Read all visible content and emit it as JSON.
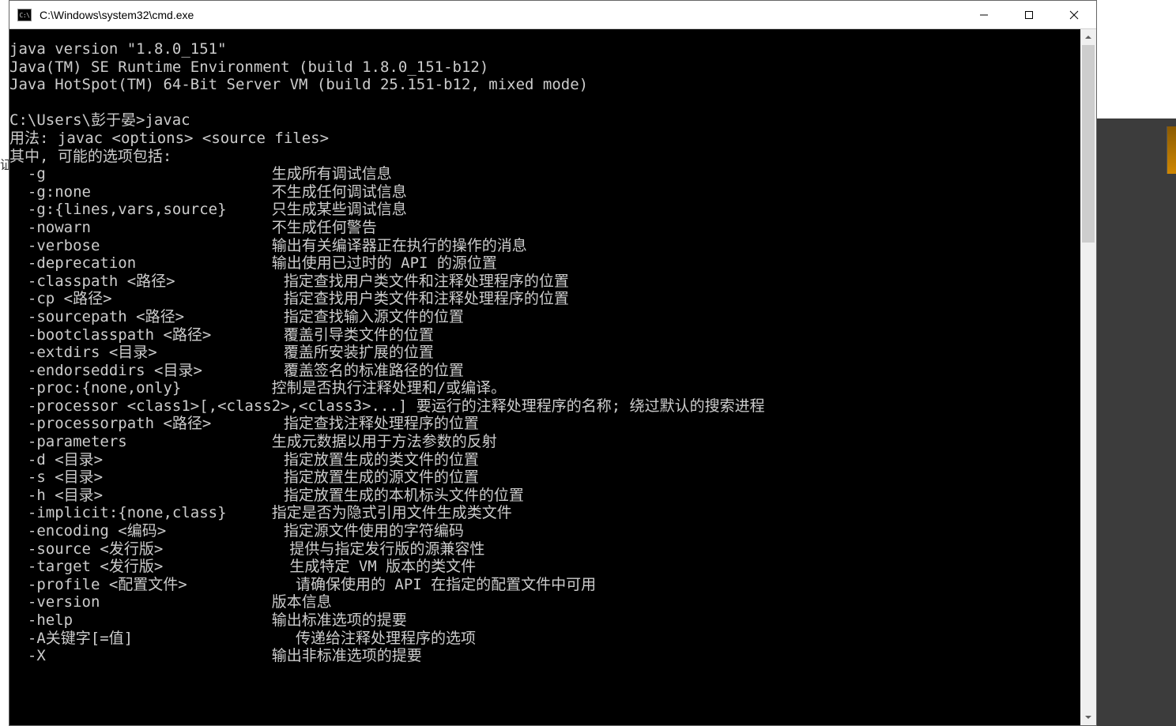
{
  "window": {
    "title": "C:\\Windows\\system32\\cmd.exe",
    "icon_label": "C:\\"
  },
  "side_text": "证",
  "console": {
    "lines": [
      "java version \"1.8.0_151\"",
      "Java(TM) SE Runtime Environment (build 1.8.0_151-b12)",
      "Java HotSpot(TM) 64-Bit Server VM (build 25.151-b12, mixed mode)",
      "",
      "C:\\Users\\彭于晏>javac",
      "用法: javac <options> <source files>",
      "其中, 可能的选项包括:",
      "  -g                         生成所有调试信息",
      "  -g:none                    不生成任何调试信息",
      "  -g:{lines,vars,source}     只生成某些调试信息",
      "  -nowarn                    不生成任何警告",
      "  -verbose                   输出有关编译器正在执行的操作的消息",
      "  -deprecation               输出使用已过时的 API 的源位置",
      "  -classpath <路径>            指定查找用户类文件和注释处理程序的位置",
      "  -cp <路径>                   指定查找用户类文件和注释处理程序的位置",
      "  -sourcepath <路径>           指定查找输入源文件的位置",
      "  -bootclasspath <路径>        覆盖引导类文件的位置",
      "  -extdirs <目录>              覆盖所安装扩展的位置",
      "  -endorseddirs <目录>         覆盖签名的标准路径的位置",
      "  -proc:{none,only}          控制是否执行注释处理和/或编译。",
      "  -processor <class1>[,<class2>,<class3>...] 要运行的注释处理程序的名称; 绕过默认的搜索进程",
      "  -processorpath <路径>        指定查找注释处理程序的位置",
      "  -parameters                生成元数据以用于方法参数的反射",
      "  -d <目录>                    指定放置生成的类文件的位置",
      "  -s <目录>                    指定放置生成的源文件的位置",
      "  -h <目录>                    指定放置生成的本机标头文件的位置",
      "  -implicit:{none,class}     指定是否为隐式引用文件生成类文件",
      "  -encoding <编码>             指定源文件使用的字符编码",
      "  -source <发行版>              提供与指定发行版的源兼容性",
      "  -target <发行版>              生成特定 VM 版本的类文件",
      "  -profile <配置文件>            请确保使用的 API 在指定的配置文件中可用",
      "  -version                   版本信息",
      "  -help                      输出标准选项的提要",
      "  -A关键字[=值]                  传递给注释处理程序的选项",
      "  -X                         输出非标准选项的提要"
    ]
  }
}
